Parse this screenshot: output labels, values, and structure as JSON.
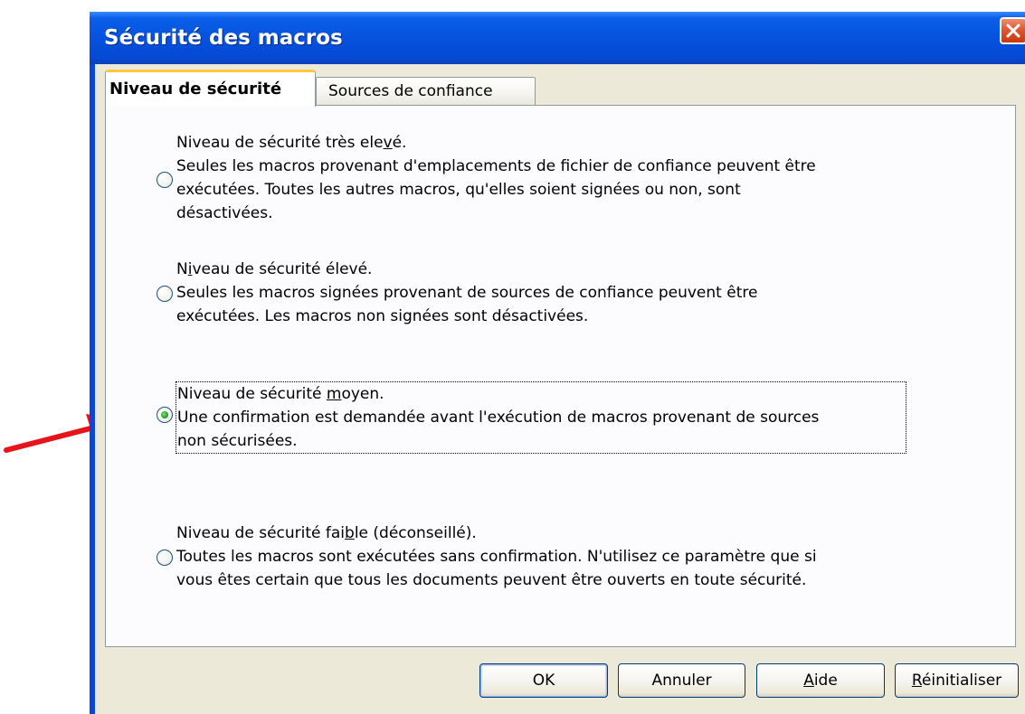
{
  "window": {
    "title": "Sécurité des macros"
  },
  "tabs": [
    {
      "label": "Niveau de sécurité",
      "selected": true
    },
    {
      "label": "Sources de confiance",
      "selected": false
    }
  ],
  "options": [
    {
      "selected": false,
      "heading_parts": [
        "Niveau de sécurité très ele",
        "v",
        "é."
      ],
      "description_lines": [
        "Seules les macros provenant d'emplacements de fichier de confiance peuvent être",
        "exécutées. Toutes les autres macros, qu'elles soient signées ou non, sont",
        "désactivées."
      ]
    },
    {
      "selected": false,
      "heading_parts": [
        "N",
        "i",
        "veau de sécurité élevé."
      ],
      "description_lines": [
        "Seules les macros signées provenant de sources de confiance peuvent être",
        "exécutées. Les macros non signées sont désactivées."
      ]
    },
    {
      "selected": true,
      "heading_parts": [
        "Niveau de sécurité ",
        "m",
        "oyen."
      ],
      "description_lines": [
        "Une confirmation est demandée avant l'exécution de macros provenant de sources",
        "non sécurisées."
      ]
    },
    {
      "selected": false,
      "heading_parts": [
        "Niveau de sécurité fai",
        "b",
        "le (déconseillé)."
      ],
      "description_lines": [
        "Toutes les macros sont exécutées sans confirmation. N'utilisez ce paramètre que si",
        "vous êtes certain que tous les documents peuvent être ouverts en toute sécurité."
      ]
    }
  ],
  "buttons": {
    "ok": "OK",
    "cancel": "Annuler",
    "help_parts": [
      "",
      "A",
      "ide"
    ],
    "reset_parts": [
      "",
      "R",
      "éinitialiser"
    ]
  },
  "colors": {
    "title_bar": "#0552df",
    "client_background": "#ece9d8",
    "annotation_arrow": "#e8141c",
    "radio_selected_dot": "#21a121"
  }
}
